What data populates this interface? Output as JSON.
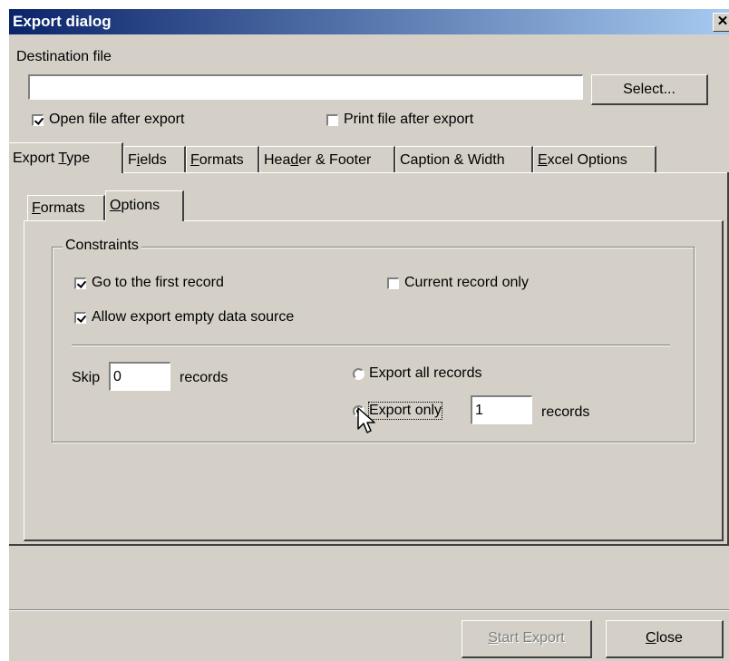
{
  "window": {
    "title": "Export dialog",
    "close_glyph": "✕"
  },
  "destination": {
    "label": "Destination file",
    "value": "",
    "select_button": "Select..."
  },
  "options": {
    "open_after": {
      "label": "Open file after export",
      "checked": true
    },
    "print_after": {
      "label": "Print file after export",
      "checked": false
    }
  },
  "tabs": [
    {
      "label_pre": "Export ",
      "mnemonic": "T",
      "label_post": "ype",
      "active": true
    },
    {
      "label_pre": "F",
      "mnemonic": "i",
      "label_post": "elds",
      "active": false
    },
    {
      "label_pre": "",
      "mnemonic": "F",
      "label_post": "ormats",
      "active": false
    },
    {
      "label_pre": "Hea",
      "mnemonic": "d",
      "label_post": "er & Footer",
      "active": false
    },
    {
      "label_pre": "Caption & Width",
      "mnemonic": "",
      "label_post": "",
      "active": false
    },
    {
      "label_pre": "",
      "mnemonic": "E",
      "label_post": "xcel Options",
      "active": false
    }
  ],
  "subtabs": [
    {
      "label_pre": "",
      "mnemonic": "F",
      "label_post": "ormats",
      "active": false
    },
    {
      "label_pre": "",
      "mnemonic": "O",
      "label_post": "ptions",
      "active": true
    }
  ],
  "constraints": {
    "legend": "Constraints",
    "first_record": {
      "label": "Go to the first record",
      "checked": true
    },
    "current_only": {
      "label": "Current record only",
      "checked": false
    },
    "allow_empty": {
      "label": "Allow export empty data source",
      "checked": true
    },
    "skip_label": "Skip",
    "skip_value": "0",
    "skip_suffix": "records",
    "export_all": {
      "label": "Export all records",
      "selected": false
    },
    "export_only": {
      "label": "Export only",
      "selected": true,
      "value": "1",
      "suffix": "records"
    }
  },
  "footer": {
    "start_pre": "",
    "start_mnemonic": "S",
    "start_post": "tart Export",
    "close_pre": "",
    "close_mnemonic": "C",
    "close_post": "lose"
  },
  "icons": {
    "cursor": "arrow-cursor-icon"
  }
}
